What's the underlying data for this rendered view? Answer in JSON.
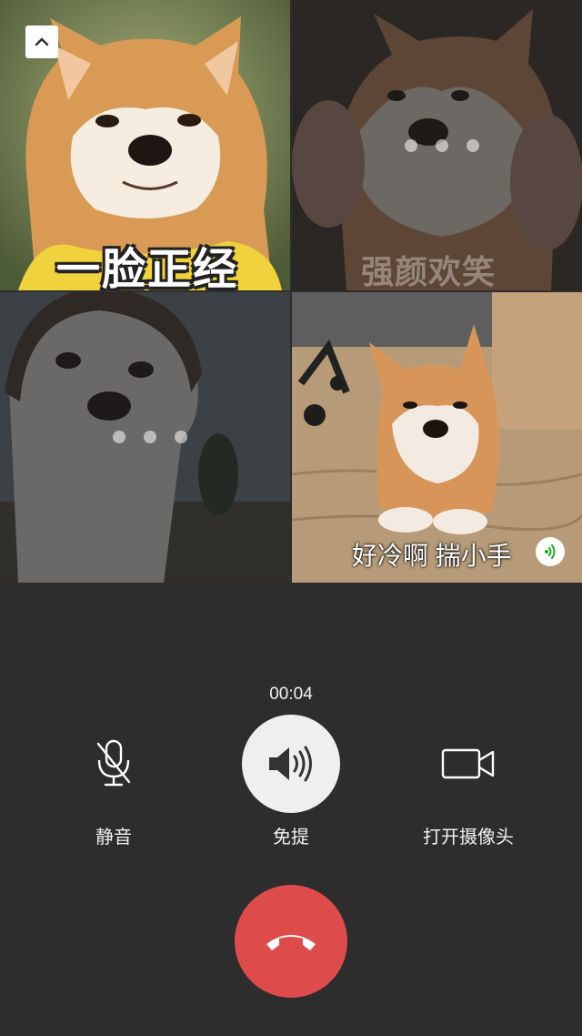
{
  "participants": [
    {
      "caption": "一脸正经",
      "status": "connected"
    },
    {
      "caption": "强颜欢笑",
      "status": "connecting"
    },
    {
      "caption": "",
      "status": "connecting"
    },
    {
      "caption": "好冷啊 揣小手",
      "status": "speaking"
    }
  ],
  "call": {
    "timer": "00:04"
  },
  "controls": {
    "mute_label": "静音",
    "speaker_label": "免提",
    "camera_label": "打开摄像头"
  },
  "icons": {
    "collapse": "chevron-up-icon",
    "add_member": "add-user-icon",
    "speaking": "voice-wave-icon",
    "mute": "mic-off-icon",
    "speaker": "speaker-icon",
    "camera": "video-camera-icon",
    "hangup": "phone-hangup-icon"
  },
  "colors": {
    "background": "#2d2d2d",
    "hangup": "#de4b4b",
    "speaker_active": "#efefef",
    "speaking_badge": "#1aad19"
  }
}
